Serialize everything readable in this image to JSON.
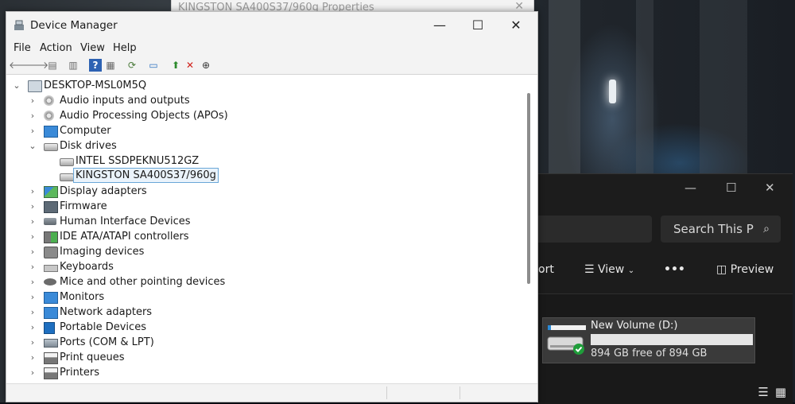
{
  "background_window": {
    "title": "KINGSTON SA400S37/960g Properties",
    "close_glyph": "✕"
  },
  "device_manager": {
    "title": "Device Manager",
    "window_controls": {
      "minimize": "—",
      "maximize": "☐",
      "close": "✕"
    },
    "menu": [
      "File",
      "Action",
      "View",
      "Help"
    ],
    "toolbar_icons": [
      "back-icon",
      "forward-icon",
      "properties-icon",
      "show-hidden-icon",
      "help-icon",
      "view-resources-icon",
      "scan-hardware-icon",
      "computer-icon",
      "update-driver-icon",
      "uninstall-icon",
      "disable-icon"
    ],
    "tree": {
      "root": "DESKTOP-MSL0M5Q",
      "items": [
        {
          "label": "Audio inputs and outputs",
          "icon": "audio-icon",
          "expanded": false
        },
        {
          "label": "Audio Processing Objects (APOs)",
          "icon": "audio-icon",
          "expanded": false
        },
        {
          "label": "Computer",
          "icon": "monitor-icon",
          "expanded": false
        },
        {
          "label": "Disk drives",
          "icon": "drive-icon",
          "expanded": true,
          "children": [
            {
              "label": "INTEL SSDPEKNU512GZ",
              "icon": "drive-icon",
              "selected": false
            },
            {
              "label": "KINGSTON SA400S37/960g",
              "icon": "drive-icon",
              "selected": true
            }
          ]
        },
        {
          "label": "Display adapters",
          "icon": "display-adapter-icon",
          "expanded": false
        },
        {
          "label": "Firmware",
          "icon": "chip-icon",
          "expanded": false
        },
        {
          "label": "Human Interface Devices",
          "icon": "hid-icon",
          "expanded": false
        },
        {
          "label": "IDE ATA/ATAPI controllers",
          "icon": "ide-icon",
          "expanded": false
        },
        {
          "label": "Imaging devices",
          "icon": "camera-icon",
          "expanded": false
        },
        {
          "label": "Keyboards",
          "icon": "keyboard-icon",
          "expanded": false
        },
        {
          "label": "Mice and other pointing devices",
          "icon": "mouse-icon",
          "expanded": false
        },
        {
          "label": "Monitors",
          "icon": "monitor-icon",
          "expanded": false
        },
        {
          "label": "Network adapters",
          "icon": "network-icon",
          "expanded": false
        },
        {
          "label": "Portable Devices",
          "icon": "portable-icon",
          "expanded": false
        },
        {
          "label": "Ports (COM & LPT)",
          "icon": "port-icon",
          "expanded": false
        },
        {
          "label": "Print queues",
          "icon": "printer-icon",
          "expanded": false
        },
        {
          "label": "Printers",
          "icon": "printer-icon",
          "expanded": false
        }
      ]
    }
  },
  "explorer": {
    "search_placeholder": "Search This P",
    "cmd_sort": "ort",
    "cmd_view": "View",
    "cmd_more": "•••",
    "cmd_preview": "Preview",
    "drive": {
      "name": "New Volume (D:)",
      "free_text": "894 GB free of 894 GB",
      "used_fraction": 0.0
    }
  }
}
